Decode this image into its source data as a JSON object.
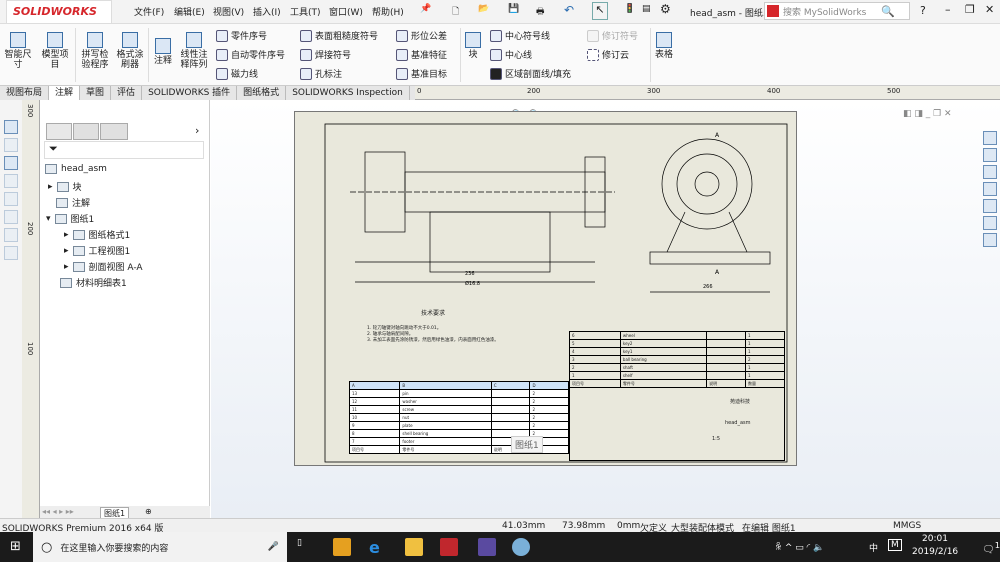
{
  "app": {
    "logo": "SOLIDWORKS",
    "doc_title": "head_asm - 图纸...",
    "search_placeholder": "搜索 MySolidWorks"
  },
  "menu": [
    "文件(F)",
    "编辑(E)",
    "视图(V)",
    "插入(I)",
    "工具(T)",
    "窗口(W)",
    "帮助(H)"
  ],
  "ribbon": {
    "big": [
      "智能尺寸",
      "模型项目",
      "拼写检验程序",
      "格式涂刷器",
      "注释",
      "线性注释阵列",
      "块",
      "表格"
    ],
    "col1": [
      "零件序号",
      "自动零件序号",
      "磁力线"
    ],
    "col2": [
      "表面粗糙度符号",
      "焊接符号",
      "孔标注"
    ],
    "col3": [
      "形位公差",
      "基准特征",
      "基准目标"
    ],
    "col4": [
      "中心符号线",
      "中心线",
      "区域剖面线/填充"
    ],
    "col5": [
      "修订符号",
      "修订云"
    ]
  },
  "tabs": [
    "视图布局",
    "注解",
    "草图",
    "评估",
    "SOLIDWORKS 插件",
    "图纸格式",
    "SOLIDWORKS Inspection"
  ],
  "ruler_top": [
    "0",
    "200",
    "300",
    "400",
    "500"
  ],
  "ruler_left": [
    "300",
    "200",
    "100"
  ],
  "tree": {
    "root": "head_asm",
    "items": [
      "块",
      "注解",
      "图纸1",
      "图纸格式1",
      "工程视图1",
      "剖面视图 A-A",
      "材料明细表1"
    ]
  },
  "sheet_tab": "图纸1",
  "drawing": {
    "tech_title": "技术要求",
    "tech_notes": [
      "1.  轮刀轴键对轴向跳动不大于0.01。",
      "2.  轴承与轴肩配间隙。",
      "3.  未加工表面先涂防锈漆，然后用绿色油漆，内表面用红色油漆。"
    ],
    "bom_right": [
      [
        "6",
        "wheel",
        "",
        "1"
      ],
      [
        "5",
        "key2",
        "",
        "1"
      ],
      [
        "4",
        "key1",
        "",
        "1"
      ],
      [
        "3",
        "ball bearing",
        "",
        "2"
      ],
      [
        "2",
        "shaft",
        "",
        "1"
      ],
      [
        "1",
        "shelf",
        "",
        "1"
      ]
    ],
    "bom_left_cols": [
      "A",
      "B",
      "C",
      "D"
    ],
    "bom_left": [
      [
        "13",
        "pin",
        "",
        "2"
      ],
      [
        "12",
        "washer",
        "",
        "2"
      ],
      [
        "11",
        "screw",
        "",
        "2"
      ],
      [
        "10",
        "nut",
        "",
        "2"
      ],
      [
        "9",
        "plate",
        "",
        "2"
      ],
      [
        "8",
        "shell bearing",
        "",
        "2"
      ],
      [
        "7",
        "footer",
        "",
        "1"
      ]
    ],
    "bom_headers": [
      "项目号",
      "零件号",
      "说明",
      "数量"
    ],
    "company": "苑迪科技",
    "part_name": "head_asm",
    "scale": "1:5",
    "dims": [
      "Ø16.8",
      "236",
      "266",
      "A",
      "A"
    ],
    "sheet_tooltip": "图纸1"
  },
  "status": {
    "product": "SOLIDWORKS Premium 2016 x64 版",
    "x": "41.03mm",
    "y": "73.98mm",
    "z": "0mm",
    "state": "欠定义",
    "mode": "大型装配体模式",
    "edit": "在编辑 图纸1",
    "units": "MMGS"
  },
  "taskbar": {
    "search": "在这里输入你要搜索的内容",
    "time": "20:01",
    "date": "2019/2/16",
    "ime": "中",
    "notif": "1"
  }
}
